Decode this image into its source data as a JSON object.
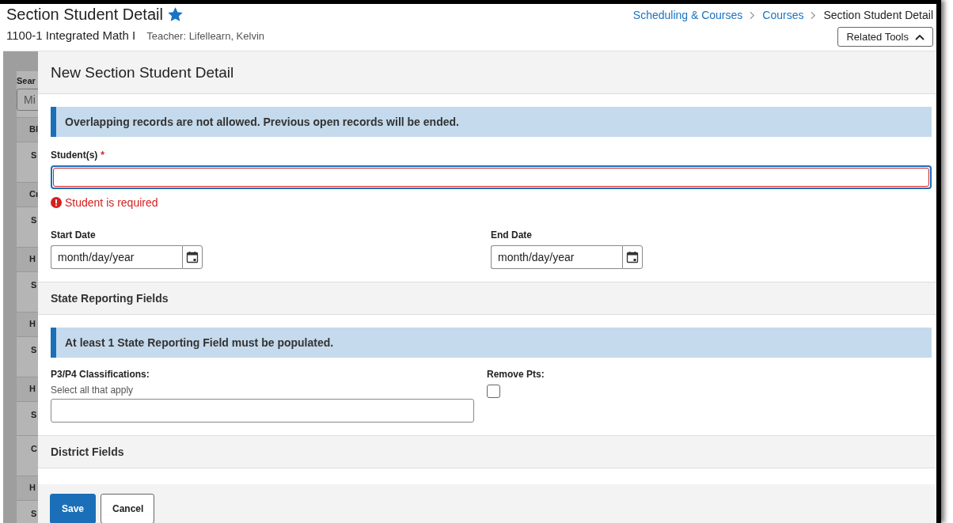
{
  "header": {
    "title": "Section Student Detail",
    "favorite": true,
    "section": "1100-1 Integrated Math I",
    "teacher": "Teacher: Lifellearn, Kelvin"
  },
  "breadcrumbs": [
    {
      "label": "Scheduling & Courses",
      "link": true
    },
    {
      "label": "Courses",
      "link": true
    },
    {
      "label": "Section Student Detail",
      "link": false
    }
  ],
  "related_tools": {
    "label": "Related Tools",
    "expanded": true
  },
  "background_panel": {
    "search_label": "Sear",
    "search_value": "Mi",
    "groups": [
      {
        "header": "Bl",
        "items": [
          "S"
        ]
      },
      {
        "header": "Cı",
        "items": [
          "S"
        ]
      },
      {
        "header": "H",
        "items": [
          "S"
        ]
      },
      {
        "header": "H",
        "items": [
          "S"
        ]
      },
      {
        "header": "H",
        "items": [
          "S",
          "C"
        ]
      },
      {
        "header": "H",
        "items": [
          "S"
        ]
      }
    ]
  },
  "modal": {
    "title": "New Section Student Detail",
    "notice": "Overlapping records are not allowed. Previous open records will be ended.",
    "students": {
      "label": "Student(s)",
      "required": true,
      "required_mark": "*",
      "error": "Student is required"
    },
    "dates": [
      {
        "label": "Start Date",
        "placeholder": "month/day/year"
      },
      {
        "label": "End Date",
        "placeholder": "month/day/year"
      }
    ],
    "sections": [
      {
        "title": "State Reporting Fields",
        "notice": "At least 1 State Reporting Field must be populated.",
        "fields": [
          {
            "kind": "multiselect",
            "label": "P3/P4 Classifications:",
            "hint": "Select all that apply"
          },
          {
            "kind": "checkbox",
            "label": "Remove Pts:",
            "checked": false
          }
        ]
      },
      {
        "title": "District Fields"
      }
    ],
    "buttons": [
      {
        "label": "Save",
        "primary": true
      },
      {
        "label": "Cancel",
        "primary": false
      }
    ]
  }
}
